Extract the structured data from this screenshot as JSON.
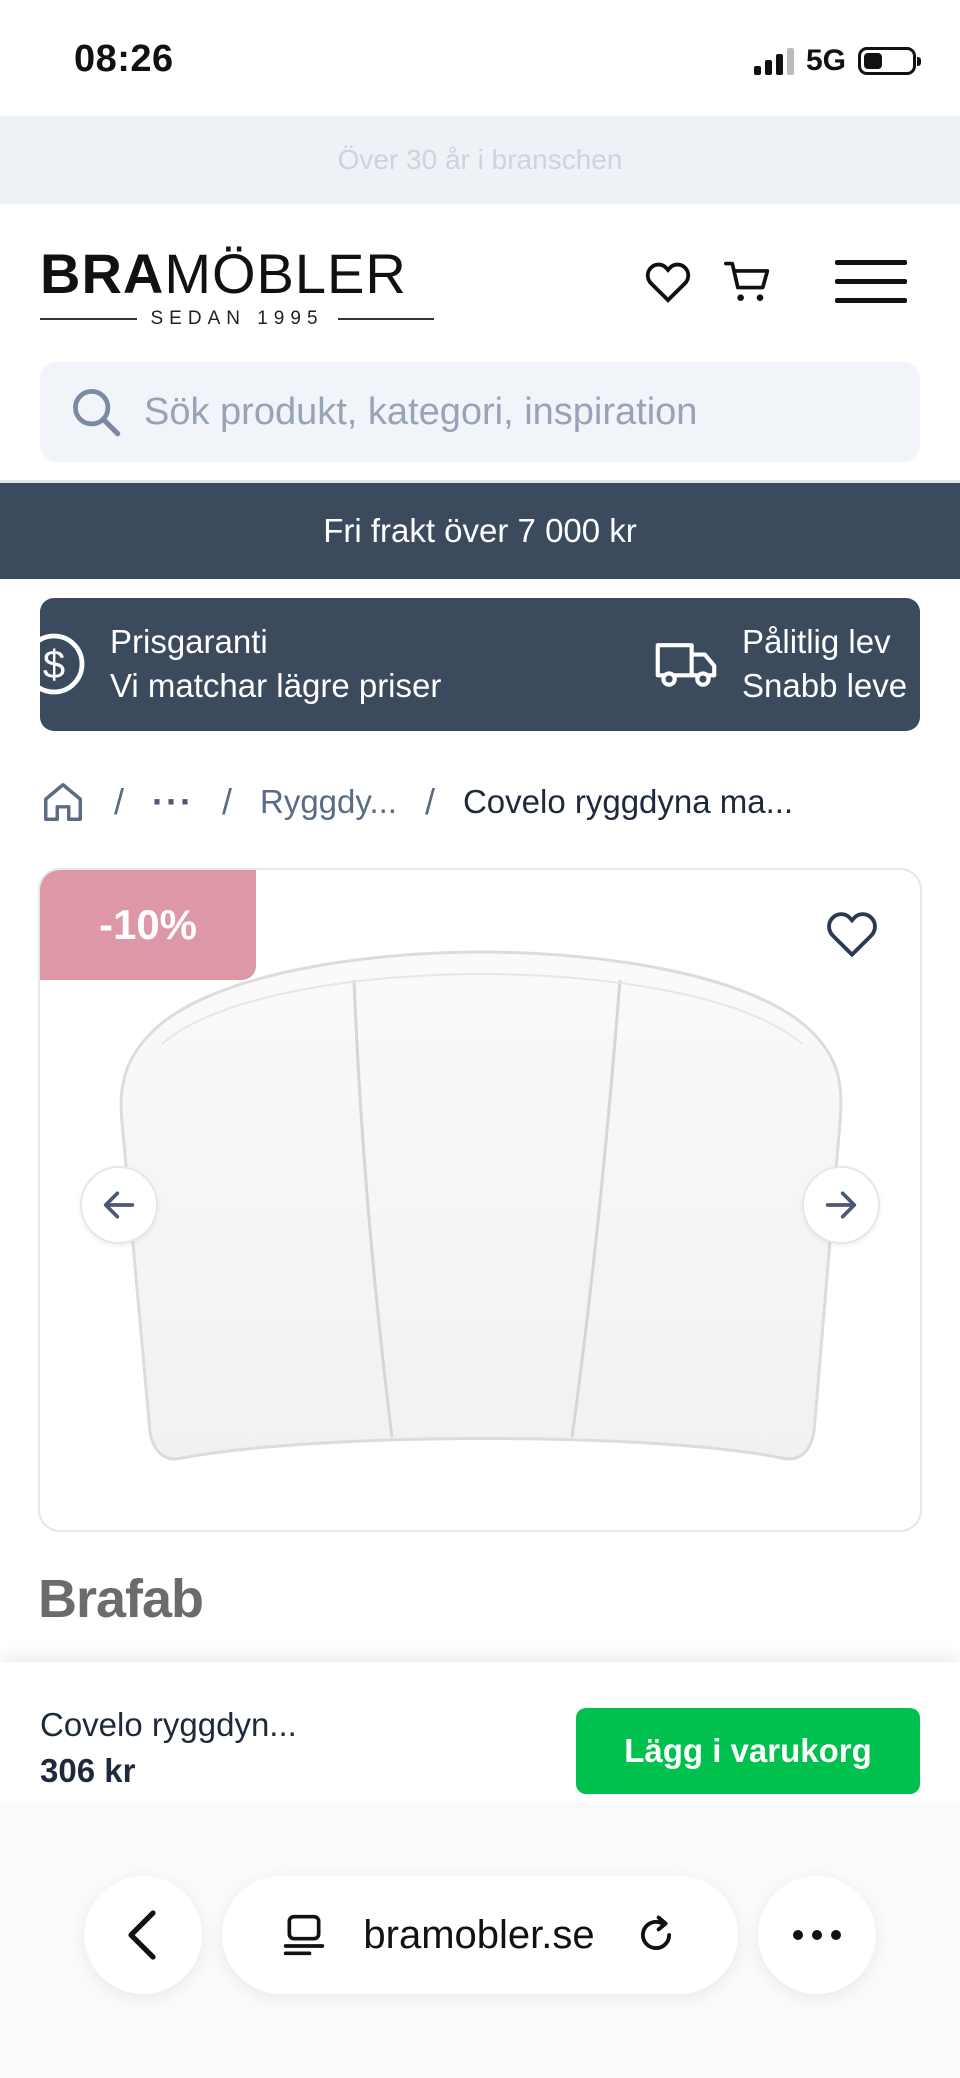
{
  "status_bar": {
    "time": "08:26",
    "network": "5G"
  },
  "promo": {
    "text": "Över 30 år i branschen"
  },
  "header": {
    "logo_bold": "BRA",
    "logo_light": "MÖBLER",
    "logo_sub": "SEDAN 1995"
  },
  "search": {
    "placeholder": "Sök produkt, kategori, inspiration"
  },
  "shipping_banner": {
    "text": "Fri frakt över 7 000 kr"
  },
  "usp": [
    {
      "icon": "dollar-icon",
      "title": "Prisgaranti",
      "subtitle": "Vi matchar lägre priser"
    },
    {
      "icon": "truck-icon",
      "title": "Pålitlig lev",
      "subtitle": "Snabb leve"
    }
  ],
  "breadcrumb": {
    "separator": "/",
    "dots": "···",
    "parent": "Ryggdy...",
    "current": "Covelo ryggdyna ma..."
  },
  "product": {
    "discount_badge": "-10%",
    "brand": "Brafab",
    "name_short": "Covelo ryggdyn...",
    "price": "306 kr",
    "add_to_cart": "Lägg i varukorg"
  },
  "browser": {
    "url": "bramobler.se"
  },
  "colors": {
    "banner": "#3c4a5e",
    "badge": "#de97a5",
    "cta": "#00c14d",
    "promo_bg": "#eef1f6"
  }
}
